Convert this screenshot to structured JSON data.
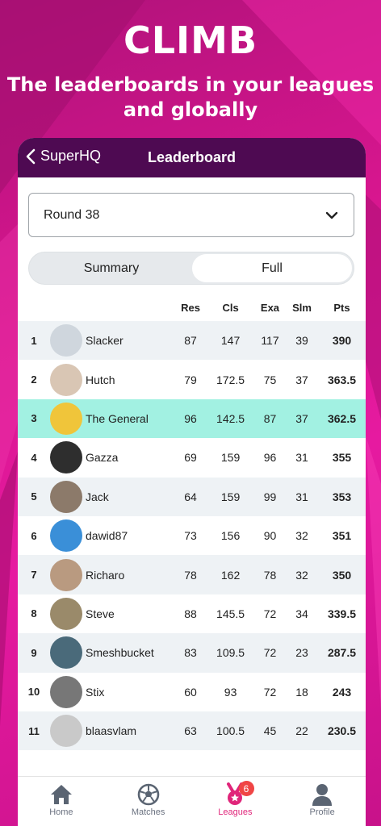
{
  "hero": {
    "title": "CLIMB",
    "subtitle_line1": "The leaderboards in your leagues",
    "subtitle_line2": "and globally"
  },
  "topbar": {
    "back_label": "SuperHQ",
    "title": "Leaderboard"
  },
  "round_select": {
    "value": "Round 38"
  },
  "segments": {
    "summary": "Summary",
    "full": "Full",
    "selected": "Full"
  },
  "table": {
    "headers": [
      "Res",
      "Cls",
      "Exa",
      "Slm",
      "Pts"
    ],
    "rows": [
      {
        "rank": "1",
        "name": "Slacker",
        "res": "87",
        "cls": "147",
        "exa": "117",
        "slm": "39",
        "pts": "390",
        "avatar_color": "#cfd6dd"
      },
      {
        "rank": "2",
        "name": "Hutch",
        "res": "79",
        "cls": "172.5",
        "exa": "75",
        "slm": "37",
        "pts": "363.5",
        "avatar_color": "#d9c6b4"
      },
      {
        "rank": "3",
        "name": "The General",
        "res": "96",
        "cls": "142.5",
        "exa": "87",
        "slm": "37",
        "pts": "362.5",
        "avatar_color": "#f0c53a",
        "highlight": true
      },
      {
        "rank": "4",
        "name": "Gazza",
        "res": "69",
        "cls": "159",
        "exa": "96",
        "slm": "31",
        "pts": "355",
        "avatar_color": "#2e2e2e"
      },
      {
        "rank": "5",
        "name": "Jack",
        "res": "64",
        "cls": "159",
        "exa": "99",
        "slm": "31",
        "pts": "353",
        "avatar_color": "#8c7a6a"
      },
      {
        "rank": "6",
        "name": "dawid87",
        "res": "73",
        "cls": "156",
        "exa": "90",
        "slm": "32",
        "pts": "351",
        "avatar_color": "#3a8fd8"
      },
      {
        "rank": "7",
        "name": "Richaro",
        "res": "78",
        "cls": "162",
        "exa": "78",
        "slm": "32",
        "pts": "350",
        "avatar_color": "#b99a80"
      },
      {
        "rank": "8",
        "name": "Steve",
        "res": "88",
        "cls": "145.5",
        "exa": "72",
        "slm": "34",
        "pts": "339.5",
        "avatar_color": "#9a8a6a"
      },
      {
        "rank": "9",
        "name": "Smeshbucket",
        "res": "83",
        "cls": "109.5",
        "exa": "72",
        "slm": "23",
        "pts": "287.5",
        "avatar_color": "#4a6a7a"
      },
      {
        "rank": "10",
        "name": "Stix",
        "res": "60",
        "cls": "93",
        "exa": "72",
        "slm": "18",
        "pts": "243",
        "avatar_color": "#777777"
      },
      {
        "rank": "11",
        "name": "blaasvlam",
        "res": "63",
        "cls": "100.5",
        "exa": "45",
        "slm": "22",
        "pts": "230.5",
        "avatar_color": "#c9c9c9"
      }
    ]
  },
  "tabbar": {
    "home": {
      "label": "Home",
      "icon": "home-icon"
    },
    "matches": {
      "label": "Matches",
      "icon": "soccer-ball-icon"
    },
    "leagues": {
      "label": "Leagues",
      "icon": "medal-icon",
      "badge": "6"
    },
    "profile": {
      "label": "Profile",
      "icon": "person-icon"
    }
  },
  "colors": {
    "accent": "#e0257a",
    "header": "#4e0a52",
    "highlight_row": "#a2f1e2",
    "background": "#d8168f"
  }
}
